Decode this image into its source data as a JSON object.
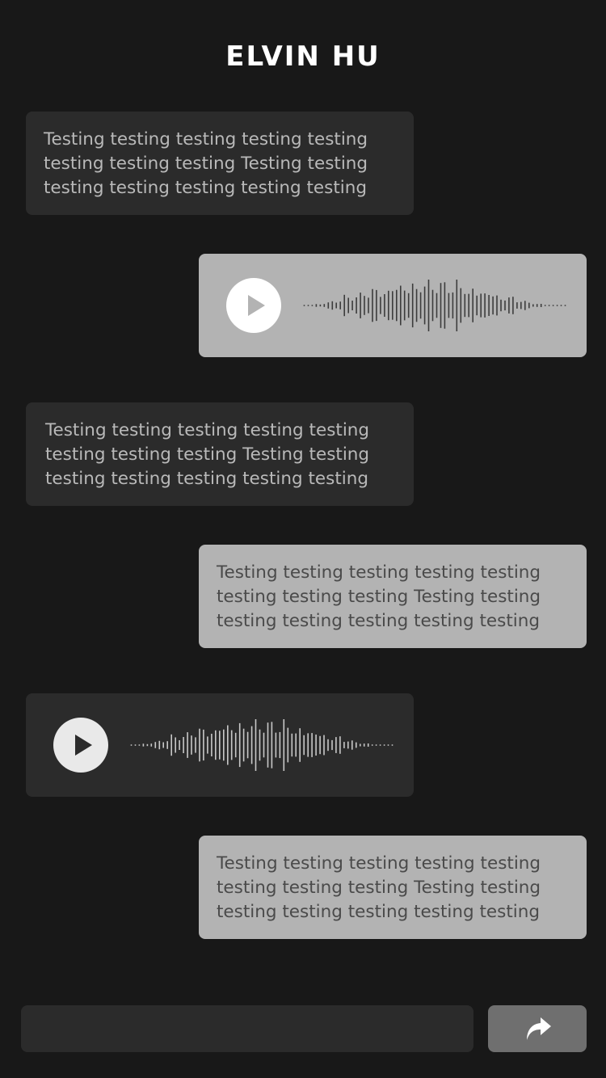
{
  "header": {
    "title": "ELVIN HU"
  },
  "messages": [
    {
      "direction": "incoming",
      "type": "text",
      "text": "Testing testing testing testing testing\ntesting testing testing Testing testing\ntesting testing testing testing testing"
    },
    {
      "direction": "outgoing",
      "type": "audio",
      "icon": "play-icon"
    },
    {
      "direction": "incoming",
      "type": "text",
      "text": "Testing testing testing testing testing\ntesting testing testing Testing testing\ntesting testing testing testing testing"
    },
    {
      "direction": "outgoing",
      "type": "text",
      "text": "Testing testing testing testing testing\ntesting testing testing Testing testing\ntesting testing testing testing testing"
    },
    {
      "direction": "incoming",
      "type": "audio",
      "icon": "play-icon"
    },
    {
      "direction": "outgoing",
      "type": "text",
      "text": "Testing testing testing testing testing\ntesting testing testing Testing testing\ntesting testing testing testing testing"
    }
  ],
  "composer": {
    "input_value": "",
    "placeholder": "",
    "send_icon": "share-arrow-icon"
  },
  "colors": {
    "background": "#181818",
    "incoming_bubble": "#2b2b2b",
    "outgoing_bubble": "#b3b3b3",
    "send_button": "#6f6f6f",
    "title": "#ffffff"
  }
}
